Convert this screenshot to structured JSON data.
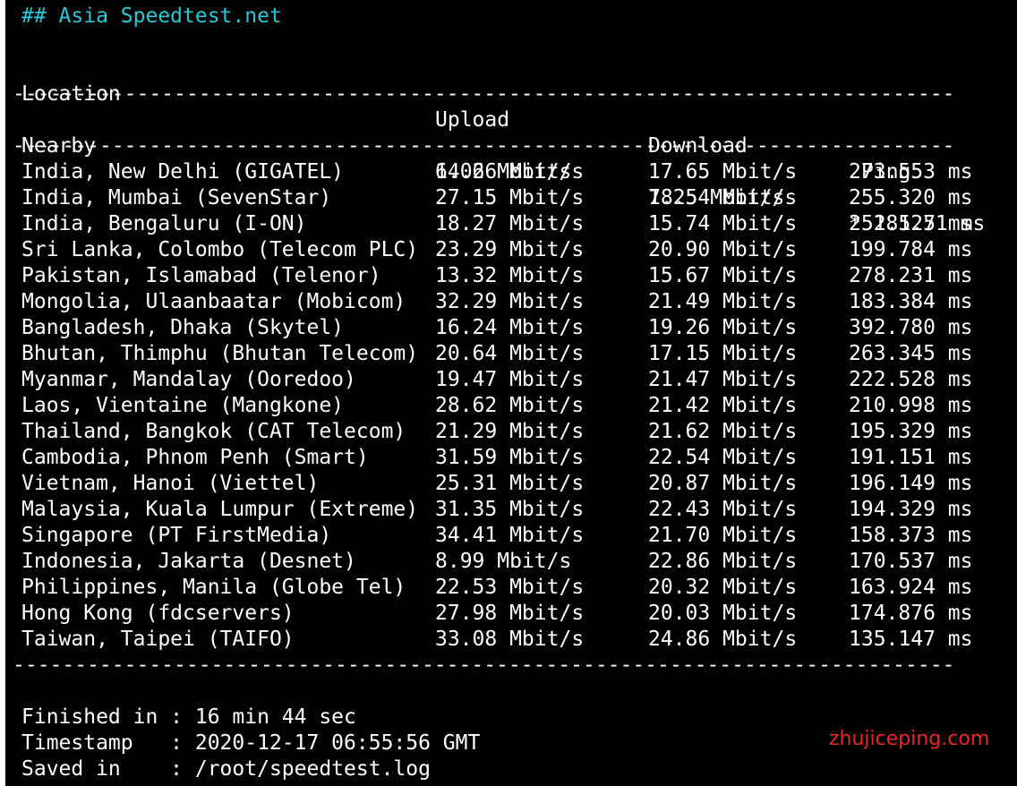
{
  "title": "## Asia Speedtest.net",
  "headers": {
    "location": "Location",
    "upload": "Upload",
    "download": "Download",
    "ping": "Ping"
  },
  "divider": "----------------------------------------------------------------------------",
  "nearby": {
    "location": "Nearby",
    "upload": "6.06 Mbit/s",
    "download": "7.25 Mbit/s",
    "ping": "* 285.71 ms"
  },
  "rows": [
    {
      "location": "India, New Delhi (GIGATEL)",
      "upload": "14.26 Mbit/s",
      "download": "17.65 Mbit/s",
      "ping": "273.553 ms"
    },
    {
      "location": "India, Mumbai (SevenStar)",
      "upload": "27.15 Mbit/s",
      "download": "18.54 Mbit/s",
      "ping": "255.320 ms"
    },
    {
      "location": "India, Bengaluru (I-ON)",
      "upload": "18.27 Mbit/s",
      "download": "15.74 Mbit/s",
      "ping": "251.125 ms"
    },
    {
      "location": "Sri Lanka, Colombo (Telecom PLC)",
      "upload": "23.29 Mbit/s",
      "download": "20.90 Mbit/s",
      "ping": "199.784 ms"
    },
    {
      "location": "Pakistan, Islamabad (Telenor)",
      "upload": "13.32 Mbit/s",
      "download": "15.67 Mbit/s",
      "ping": "278.231 ms"
    },
    {
      "location": "Mongolia, Ulaanbaatar (Mobicom)",
      "upload": "32.29 Mbit/s",
      "download": "21.49 Mbit/s",
      "ping": "183.384 ms"
    },
    {
      "location": "Bangladesh, Dhaka (Skytel)",
      "upload": "16.24 Mbit/s",
      "download": "19.26 Mbit/s",
      "ping": "392.780 ms"
    },
    {
      "location": "Bhutan, Thimphu (Bhutan Telecom)",
      "upload": "20.64 Mbit/s",
      "download": "17.15 Mbit/s",
      "ping": "263.345 ms"
    },
    {
      "location": "Myanmar, Mandalay (Ooredoo)",
      "upload": "19.47 Mbit/s",
      "download": "21.47 Mbit/s",
      "ping": "222.528 ms"
    },
    {
      "location": "Laos, Vientaine (Mangkone)",
      "upload": "28.62 Mbit/s",
      "download": "21.42 Mbit/s",
      "ping": "210.998 ms"
    },
    {
      "location": "Thailand, Bangkok (CAT Telecom)",
      "upload": "21.29 Mbit/s",
      "download": "21.62 Mbit/s",
      "ping": "195.329 ms"
    },
    {
      "location": "Cambodia, Phnom Penh (Smart)",
      "upload": "31.59 Mbit/s",
      "download": "22.54 Mbit/s",
      "ping": "191.151 ms"
    },
    {
      "location": "Vietnam, Hanoi (Viettel)",
      "upload": "25.31 Mbit/s",
      "download": "20.87 Mbit/s",
      "ping": "196.149 ms"
    },
    {
      "location": "Malaysia, Kuala Lumpur (Extreme)",
      "upload": "31.35 Mbit/s",
      "download": "22.43 Mbit/s",
      "ping": "194.329 ms"
    },
    {
      "location": "Singapore (PT FirstMedia)",
      "upload": "34.41 Mbit/s",
      "download": "21.70 Mbit/s",
      "ping": "158.373 ms"
    },
    {
      "location": "Indonesia, Jakarta (Desnet)",
      "upload": "8.99 Mbit/s",
      "download": "22.86 Mbit/s",
      "ping": "170.537 ms"
    },
    {
      "location": "Philippines, Manila (Globe Tel)",
      "upload": "22.53 Mbit/s",
      "download": "20.32 Mbit/s",
      "ping": "163.924 ms"
    },
    {
      "location": "Hong Kong (fdcservers)",
      "upload": "27.98 Mbit/s",
      "download": "20.03 Mbit/s",
      "ping": "174.876 ms"
    },
    {
      "location": "Taiwan, Taipei (TAIFO)",
      "upload": "33.08 Mbit/s",
      "download": "24.86 Mbit/s",
      "ping": "135.147 ms"
    }
  ],
  "summary": {
    "finished": "Finished in : 16 min 44 sec",
    "timestamp": "Timestamp   : 2020-12-17 06:55:56 GMT",
    "saved": "Saved in    : /root/speedtest.log"
  },
  "watermark": "zhujiceping.com",
  "colors": {
    "background": "#000000",
    "text": "#ffffff",
    "title": "#28c8d6",
    "watermark": "#e8262a"
  }
}
